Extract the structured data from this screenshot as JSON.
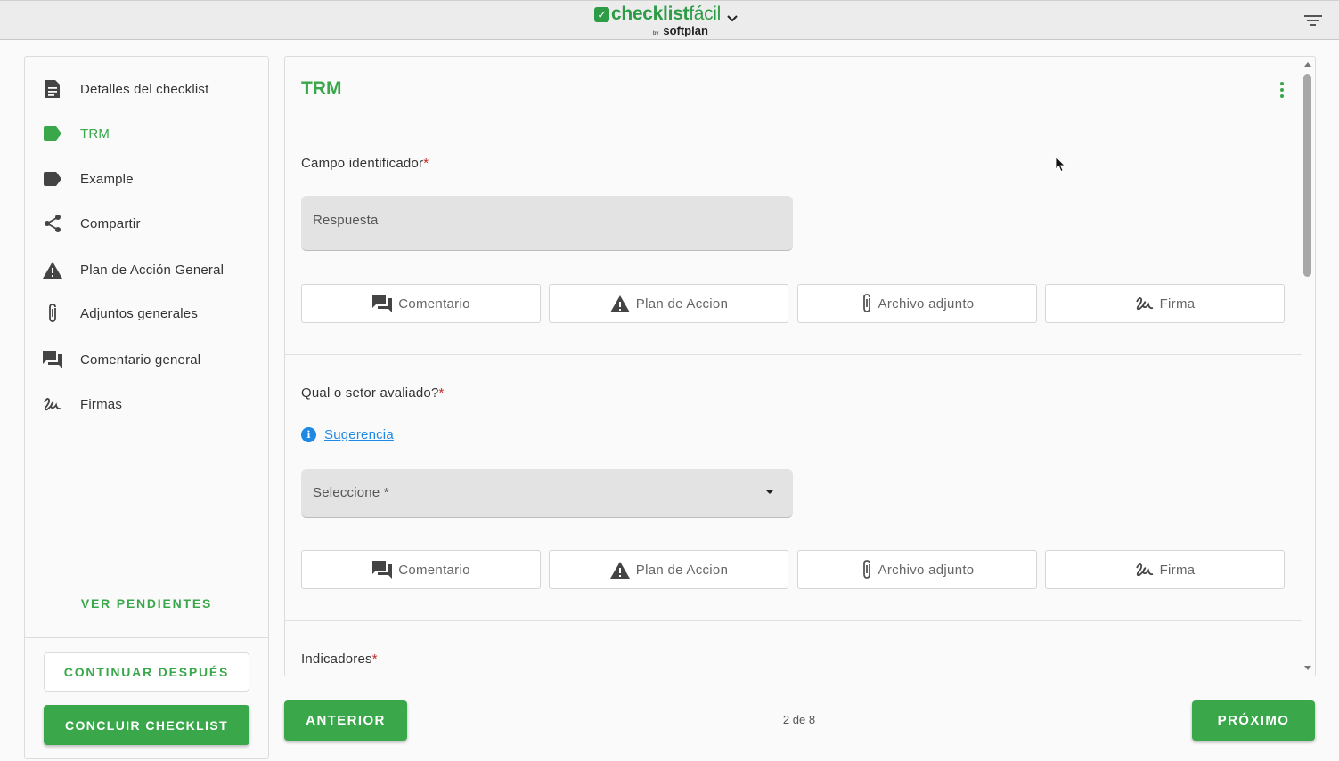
{
  "header": {
    "logo_main": "checklist",
    "logo_light": "fácil",
    "logo_by": "by",
    "logo_sub": "softplan",
    "icons": [
      "check-icon",
      "chevron-down-icon",
      "filter-list-icon"
    ]
  },
  "sidebar": {
    "items": [
      {
        "label": "Detalles del checklist",
        "icon": "document-icon"
      },
      {
        "label": "TRM",
        "icon": "label-icon",
        "active": true
      },
      {
        "label": "Example",
        "icon": "label-icon"
      },
      {
        "label": "Compartir",
        "icon": "share-icon"
      },
      {
        "label": "Plan de Acción General",
        "icon": "warning-icon"
      },
      {
        "label": "Adjuntos generales",
        "icon": "paperclip-icon"
      },
      {
        "label": "Comentario general",
        "icon": "forum-icon"
      },
      {
        "label": "Firmas",
        "icon": "signature-icon"
      }
    ],
    "ver_pendientes": "VER PENDIENTES",
    "continuar": "CONTINUAR DESPUÉS",
    "concluir": "CONCLUIR CHECKLIST"
  },
  "main": {
    "title": "TRM",
    "questions": [
      {
        "label": "Campo identificador",
        "required": "*",
        "input_placeholder": "Respuesta"
      },
      {
        "label": "Qual o setor avaliado?",
        "required": "*",
        "suggestion": "Sugerencia",
        "select_placeholder": "Seleccione *"
      },
      {
        "label": "Indicadores",
        "required": "*"
      }
    ],
    "actions": {
      "comentario": "Comentario",
      "plan": "Plan de Accion",
      "archivo": "Archivo adjunto",
      "firma": "Firma"
    }
  },
  "footer": {
    "anterior": "ANTERIOR",
    "pager": "2 de 8",
    "proximo": "PRÓXIMO"
  },
  "colors": {
    "accent": "#3aa74b",
    "link": "#1e88e5",
    "required": "#c62828"
  }
}
